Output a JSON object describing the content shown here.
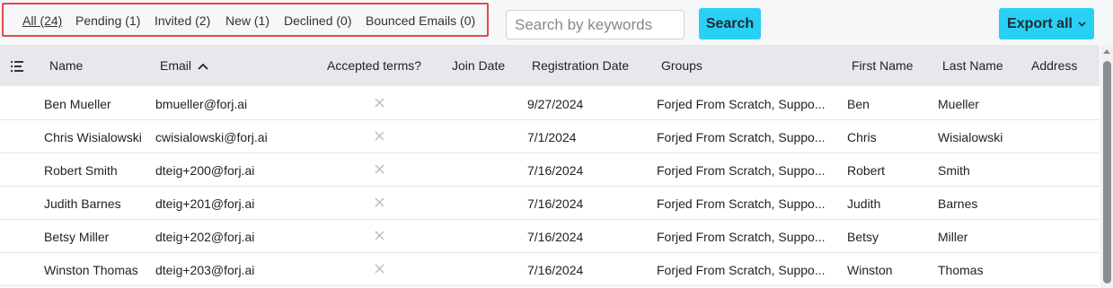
{
  "filters": [
    {
      "label": "All (24)",
      "active": true
    },
    {
      "label": "Pending (1)",
      "active": false
    },
    {
      "label": "Invited (2)",
      "active": false
    },
    {
      "label": "New (1)",
      "active": false
    },
    {
      "label": "Declined (0)",
      "active": false
    },
    {
      "label": "Bounced Emails (0)",
      "active": false
    }
  ],
  "search": {
    "placeholder": "Search by keywords",
    "button_label": "Search"
  },
  "export": {
    "label": "Export all"
  },
  "colors": {
    "accent": "#29d0f3",
    "highlight_border": "#e04a4a",
    "header_bg": "#e6e8ec"
  },
  "table": {
    "headers": {
      "name": "Name",
      "email": "Email",
      "accepted_terms": "Accepted terms?",
      "join_date": "Join Date",
      "registration_date": "Registration Date",
      "groups": "Groups",
      "first_name": "First Name",
      "last_name": "Last Name",
      "address": "Address"
    },
    "sort": {
      "column": "email",
      "direction": "ascending"
    },
    "rows": [
      {
        "name": "Ben Mueller",
        "email": "bmueller@forj.ai",
        "accepted_terms": false,
        "join_date": "",
        "registration_date": "9/27/2024",
        "groups": "Forjed From Scratch,  Suppo...",
        "first_name": "Ben",
        "last_name": "Mueller",
        "address": ""
      },
      {
        "name": "Chris Wisialowski",
        "email": "cwisialowski@forj.ai",
        "accepted_terms": false,
        "join_date": "",
        "registration_date": "7/1/2024",
        "groups": "Forjed From Scratch,  Suppo...",
        "first_name": "Chris",
        "last_name": "Wisialowski",
        "address": ""
      },
      {
        "name": "Robert Smith",
        "email": "dteig+200@forj.ai",
        "accepted_terms": false,
        "join_date": "",
        "registration_date": "7/16/2024",
        "groups": "Forjed From Scratch,  Suppo...",
        "first_name": "Robert",
        "last_name": "Smith",
        "address": ""
      },
      {
        "name": "Judith Barnes",
        "email": "dteig+201@forj.ai",
        "accepted_terms": false,
        "join_date": "",
        "registration_date": "7/16/2024",
        "groups": "Forjed From Scratch,  Suppo...",
        "first_name": "Judith",
        "last_name": "Barnes",
        "address": ""
      },
      {
        "name": "Betsy Miller",
        "email": "dteig+202@forj.ai",
        "accepted_terms": false,
        "join_date": "",
        "registration_date": "7/16/2024",
        "groups": "Forjed From Scratch,  Suppo...",
        "first_name": "Betsy",
        "last_name": "Miller",
        "address": ""
      },
      {
        "name": "Winston Thomas",
        "email": "dteig+203@forj.ai",
        "accepted_terms": false,
        "join_date": "",
        "registration_date": "7/16/2024",
        "groups": "Forjed From Scratch,  Suppo...",
        "first_name": "Winston",
        "last_name": "Thomas",
        "address": ""
      }
    ]
  },
  "icons": {
    "columns": "column-list-icon",
    "sort": "sort-ascending-icon",
    "rejected": "x-mark-icon",
    "dropdown": "chevron-down-icon"
  }
}
